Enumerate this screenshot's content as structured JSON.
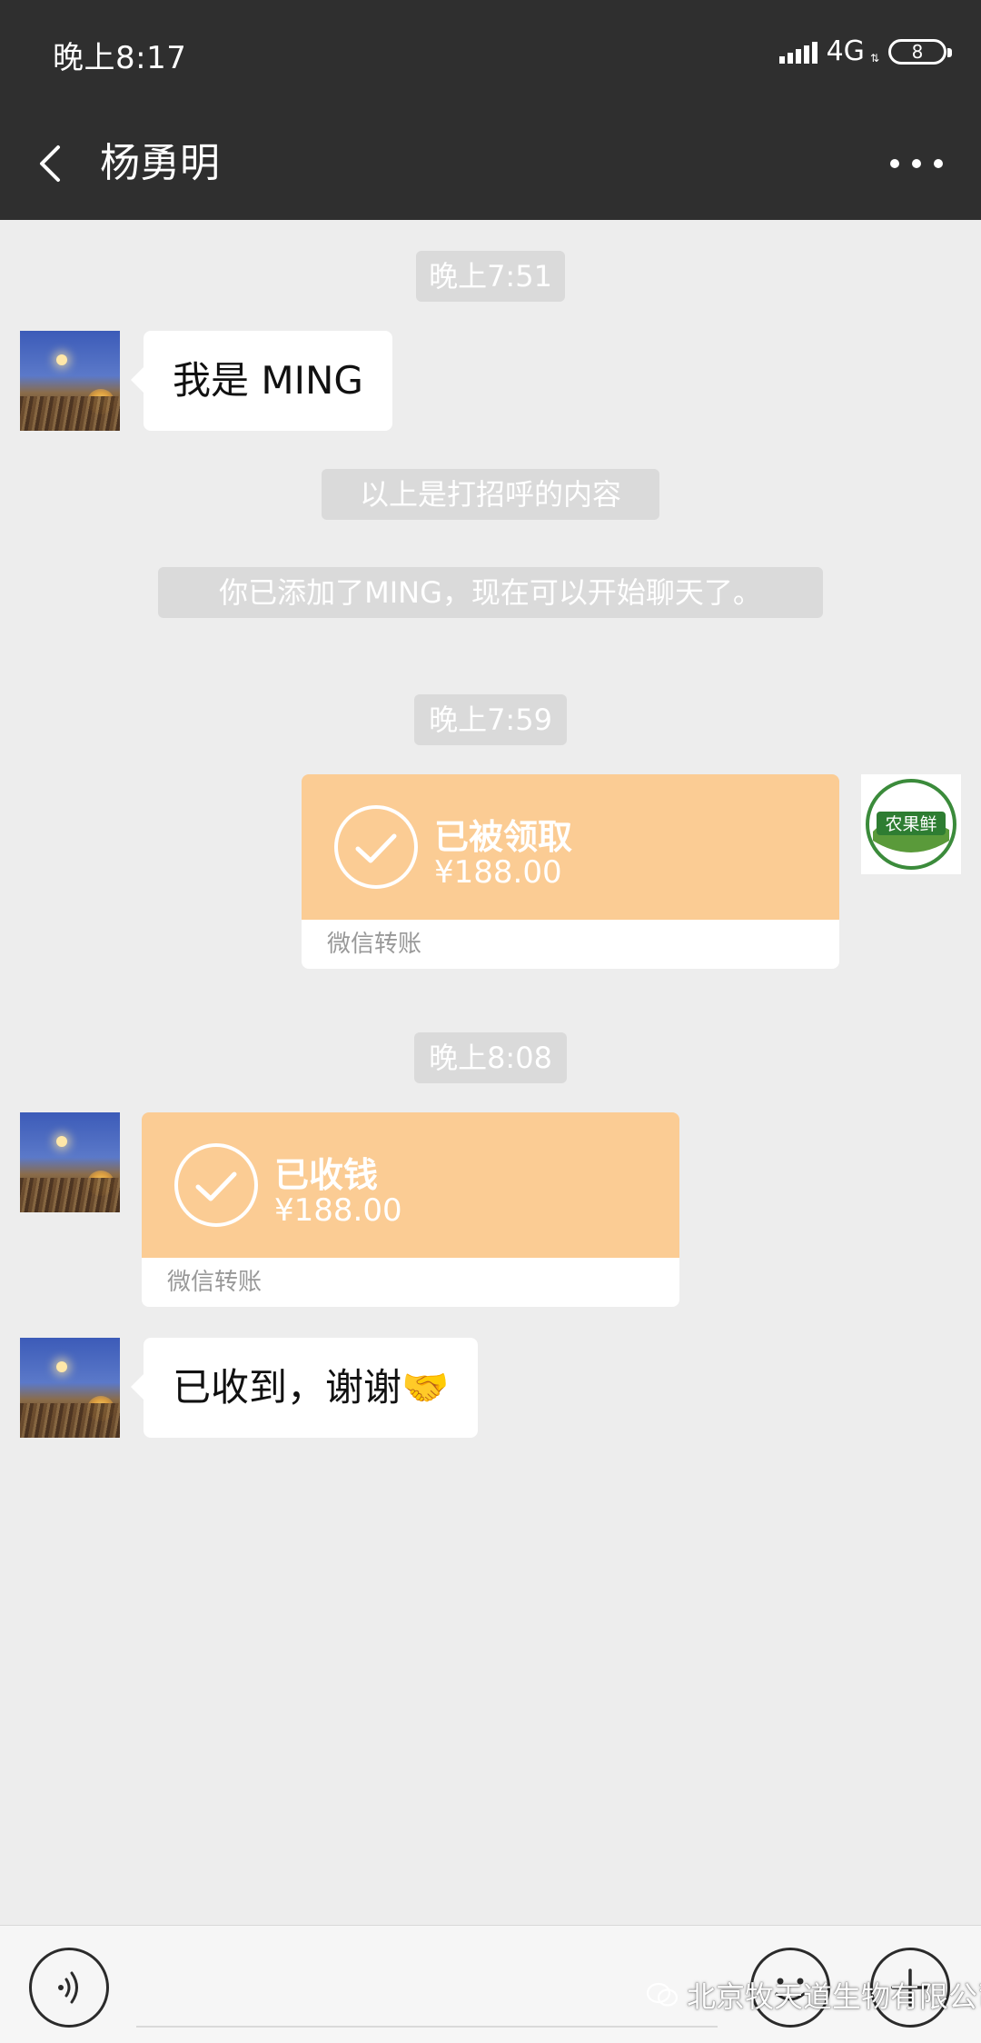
{
  "status_bar": {
    "time": "晚上8:17",
    "network": "4G",
    "battery": "8"
  },
  "header": {
    "title": "杨勇明"
  },
  "messages": {
    "ts1": "晚上7:51",
    "greeting": "我是 MING",
    "note1": "以上是打招呼的内容",
    "note2": "你已添加了MING，现在可以开始聊天了。",
    "ts2": "晚上7:59",
    "transfer1": {
      "status": "已被领取",
      "amount": "¥188.00",
      "footer": "微信转账"
    },
    "ts3": "晚上8:08",
    "transfer2": {
      "status": "已收钱",
      "amount": "¥188.00",
      "footer": "微信转账"
    },
    "thanks": "已收到，谢谢🤝"
  },
  "sender_avatar": {
    "logo_text": "农果鲜"
  },
  "watermark": {
    "text": "北京牧天道生物有限公司"
  },
  "colors": {
    "header_bg": "#2f2f2f",
    "chat_bg": "#ededed",
    "transfer_bg": "#fbcc94"
  }
}
